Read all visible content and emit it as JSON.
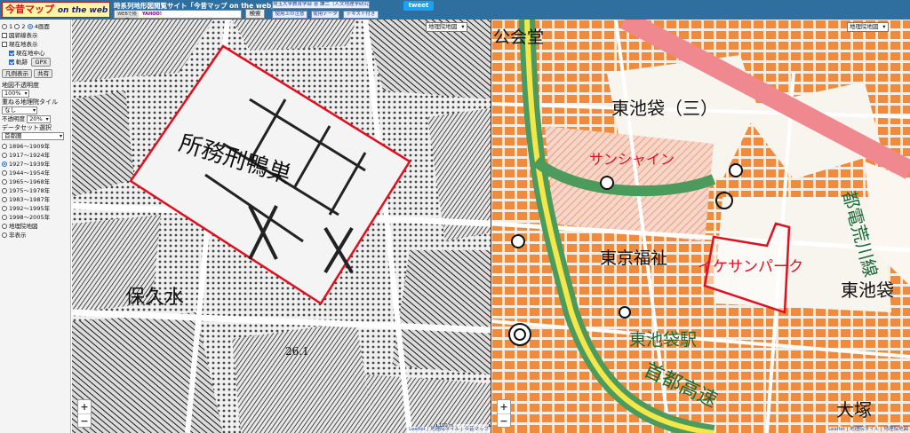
{
  "header": {
    "logo_main": "今昔マップ",
    "logo_sub": "on the web",
    "subtitle": "時系列地形図閲覧サイト「今昔マップ on the web」",
    "search_ix": "WEBで検索",
    "search_yahoo": "YAHOO!",
    "search_button": "検索",
    "link_univ": "埼玉大学教育学部 谷 謙二（人文地理学研究室）",
    "link_usage": "使用上の注意",
    "link_data": "使用データ",
    "link_text": "テキスト付き",
    "tweet_label": "tweet"
  },
  "panel": {
    "screen_opts": [
      {
        "label": "1",
        "selected": false
      },
      {
        "label": "2",
        "selected": false
      },
      {
        "label": "4画面",
        "selected": true
      }
    ],
    "chk_range": "図郭線表示",
    "chk_current": "現在地表示",
    "chk_center": "現在地中心",
    "chk_track": "軌跡",
    "gpx_button": "GPX",
    "legend_button": "凡例表示",
    "share_button": "共有",
    "opacity_label": "地図不透明度",
    "opacity_value": "100%",
    "overlay_label": "重ねる地理院タイル",
    "overlay_value": "なし",
    "opacity2_label": "不透明度",
    "opacity2_value": "20%",
    "dataset_label": "データセット選択",
    "dataset_value": "首都圏",
    "periods": [
      {
        "label": "1896〜1909年",
        "selected": false
      },
      {
        "label": "1917〜1924年",
        "selected": false
      },
      {
        "label": "1927〜1939年",
        "selected": true
      },
      {
        "label": "1944〜1954年",
        "selected": false
      },
      {
        "label": "1965〜1968年",
        "selected": false
      },
      {
        "label": "1975〜1978年",
        "selected": false
      },
      {
        "label": "1983〜1987年",
        "selected": false
      },
      {
        "label": "1992〜1995年",
        "selected": false
      },
      {
        "label": "1998〜2005年",
        "selected": false
      },
      {
        "label": "地理院地図",
        "selected": false
      },
      {
        "label": "非表示",
        "selected": false
      }
    ]
  },
  "map_left": {
    "layer_select": "地理院地図",
    "labels": {
      "prison": "所務刑鴨巣",
      "hozu": "保久水",
      "code": "26.1"
    },
    "scale": "100 m",
    "attribution": "Leaflet | 地理院タイル | 今昔マップ"
  },
  "map_right": {
    "layer_select": "地理院地図",
    "labels": {
      "kokaido": "公会堂",
      "higashi3": "東池袋（三）",
      "sunshine": "サンシャイン",
      "fukushi": "東京福祉",
      "ikesun": "イケサンパーク",
      "station": "東池袋駅",
      "shuto": "首都高速",
      "toden": "都電荒川線",
      "higashiike": "東池袋",
      "otsuka": "大塚"
    },
    "scale": "100 m",
    "attribution": "Leaflet | 地理院タイル | 地理院地図",
    "colors": {
      "building": "#f08a3c",
      "highway": "#5aa86a",
      "road_yellow": "#f4e74a",
      "arterial": "#f08890",
      "outline": "#e01020"
    }
  }
}
